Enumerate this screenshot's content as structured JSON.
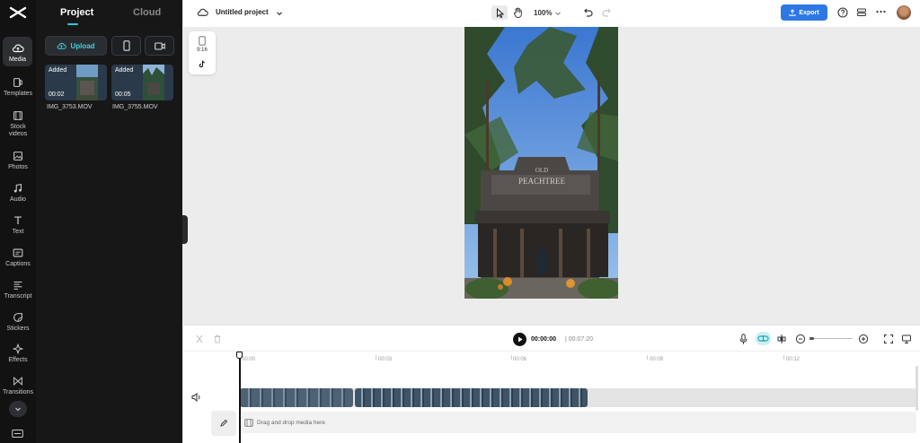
{
  "rail": {
    "items": [
      {
        "label": "Media",
        "icon": "cloud-media-icon"
      },
      {
        "label": "Templates",
        "icon": "templates-icon"
      },
      {
        "label": "Stock videos",
        "icon": "film-icon"
      },
      {
        "label": "Photos",
        "icon": "photo-icon"
      },
      {
        "label": "Audio",
        "icon": "music-note-icon"
      },
      {
        "label": "Text",
        "icon": "text-icon"
      },
      {
        "label": "Captions",
        "icon": "captions-icon"
      },
      {
        "label": "Transcript",
        "icon": "transcript-icon"
      },
      {
        "label": "Stickers",
        "icon": "sticker-icon"
      },
      {
        "label": "Effects",
        "icon": "sparkle-icon"
      },
      {
        "label": "Transitions",
        "icon": "transition-icon"
      }
    ]
  },
  "panel": {
    "tabs": [
      "Project",
      "Cloud"
    ],
    "upload_label": "Upload",
    "media": [
      {
        "badge": "Added",
        "duration": "00:02",
        "name": "IMG_3753.MOV"
      },
      {
        "badge": "Added",
        "duration": "00:05",
        "name": "IMG_3755.MOV"
      }
    ]
  },
  "topbar": {
    "title": "Untitled project",
    "zoom": "100%",
    "export_label": "Export"
  },
  "canvas": {
    "ratio": "9:16"
  },
  "timeline": {
    "current_time": "00:00:00",
    "total_time": "| 00:07:20",
    "ruler": [
      "00:00",
      "00:03",
      "00:06",
      "00:09",
      "00:12"
    ],
    "drop_text": "Drag and drop media here"
  },
  "colors": {
    "accent": "#2bc9d6",
    "export": "#2e78e6",
    "rail_bg": "#121212",
    "panel_bg": "#171717"
  }
}
